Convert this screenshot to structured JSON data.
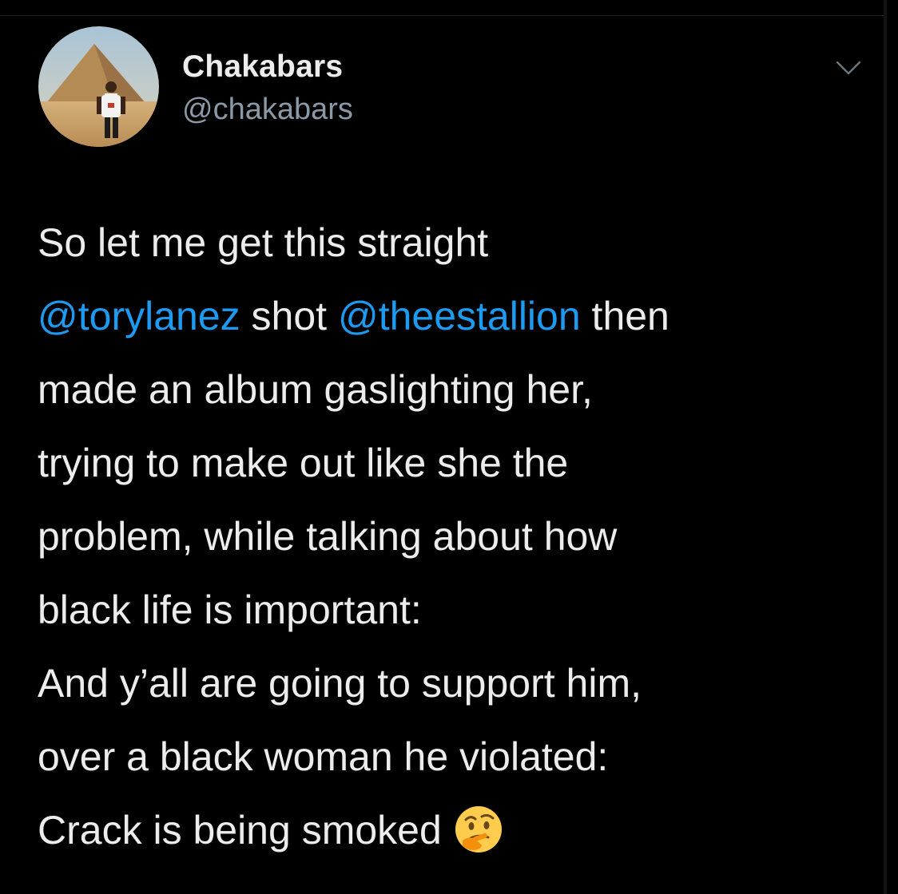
{
  "tweet": {
    "author": {
      "display_name": "Chakabars",
      "handle": "@chakabars"
    },
    "lines": {
      "l1": "So let me get this straight",
      "l2_mention1": "@torylanez",
      "l2_mid": " shot ",
      "l2_mention2": "@theestallion",
      "l2_end": " then",
      "l3": "made an album gaslighting her,",
      "l4": "trying to make out like she the",
      "l5": "problem, while talking about how",
      "l6": "black life is important:",
      "l7": "And y’all are going to support him,",
      "l8": "over a black woman he violated:",
      "l9": "Crack is being smoked"
    },
    "emoji_icon": "thinking-face-icon",
    "menu_icon": "chevron-down-icon"
  },
  "colors": {
    "background": "#000000",
    "text": "#ececec",
    "secondary_text": "#8b98a5",
    "mention": "#1d9bf0"
  }
}
